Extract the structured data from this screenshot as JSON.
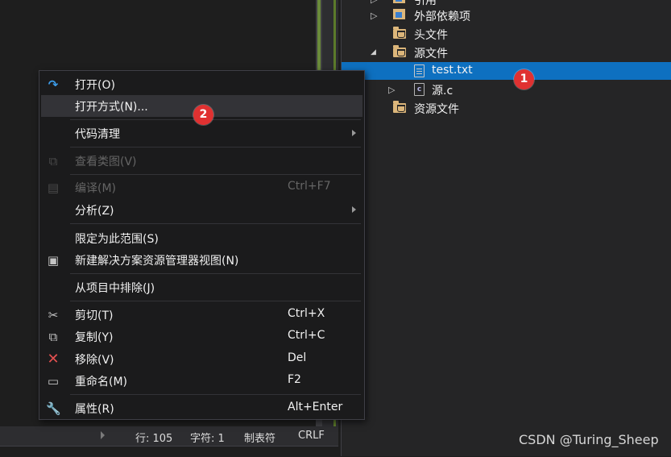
{
  "explorer": {
    "items": [
      {
        "label": "引用",
        "arrow": "▷"
      },
      {
        "label": "外部依赖项",
        "arrow": "▷"
      },
      {
        "label": "头文件",
        "arrow": ""
      },
      {
        "label": "源文件",
        "arrow": "◢"
      },
      {
        "label": "test.txt",
        "arrow": "",
        "selected": true
      },
      {
        "label": "源.c",
        "arrow": "▷"
      },
      {
        "label": "资源文件",
        "arrow": ""
      }
    ]
  },
  "badges": {
    "one": "1",
    "two": "2"
  },
  "context_menu": {
    "items": [
      {
        "label": "打开(O)",
        "shortcut": "",
        "icon": "open-icon"
      },
      {
        "label": "打开方式(N)...",
        "shortcut": "",
        "icon": ""
      },
      {
        "label": "代码清理",
        "shortcut": "",
        "icon": ""
      },
      {
        "label": "查看类图(V)",
        "shortcut": "",
        "icon": "class-diagram-icon",
        "disabled": true
      },
      {
        "label": "编译(M)",
        "shortcut": "Ctrl+F7",
        "icon": "compile-icon",
        "disabled": true
      },
      {
        "label": "分析(Z)",
        "shortcut": "",
        "icon": ""
      },
      {
        "label": "限定为此范围(S)",
        "shortcut": "",
        "icon": ""
      },
      {
        "label": "新建解决方案资源管理器视图(N)",
        "shortcut": "",
        "icon": "new-view-icon"
      },
      {
        "label": "从项目中排除(J)",
        "shortcut": "",
        "icon": ""
      },
      {
        "label": "剪切(T)",
        "shortcut": "Ctrl+X",
        "icon": "cut-icon"
      },
      {
        "label": "复制(Y)",
        "shortcut": "Ctrl+C",
        "icon": "copy-icon"
      },
      {
        "label": "移除(V)",
        "shortcut": "Del",
        "icon": "remove-icon"
      },
      {
        "label": "重命名(M)",
        "shortcut": "F2",
        "icon": "rename-icon"
      },
      {
        "label": "属性(R)",
        "shortcut": "Alt+Enter",
        "icon": "properties-icon"
      }
    ]
  },
  "status_bar": {
    "line": "行: 105",
    "char": "字符: 1",
    "tabs": "制表符",
    "eol": "CRLF"
  },
  "watermark": "CSDN @Turing_Sheep",
  "colors": {
    "selection": "#0e70c0",
    "badge": "#e03131",
    "menu_bg": "#1b1b1c",
    "menu_hover": "#333337",
    "folder": "#dcb67a"
  }
}
